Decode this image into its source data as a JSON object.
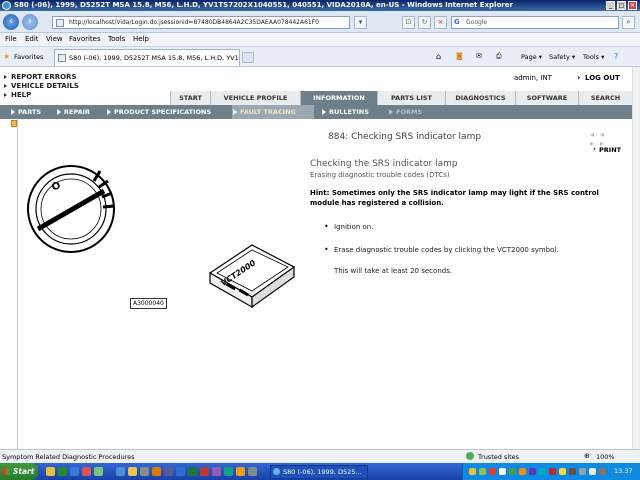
{
  "window": {
    "title": "S80 (-06), 1999, D5252T MSA 15.8, M56, L.H.D, YV1TS7202X1040551, 040551, VIDA2010A, en-US - Windows Internet Explorer"
  },
  "address_bar": {
    "url": "http://localhost/Vida/Login.do;jsessionid=87480DB4864A2C35DAEAA078442A61F0",
    "search_placeholder": "Google"
  },
  "menu": [
    "File",
    "Edit",
    "View",
    "Favorites",
    "Tools",
    "Help"
  ],
  "favorites_bar": {
    "favorites_label": "Favorites",
    "tab_title": "S80 (-06), 1999, D5252T MSA 15.8, M56, L.H.D, YV1...",
    "commands": [
      "Page ▾",
      "Safety ▾",
      "Tools ▾"
    ]
  },
  "vida": {
    "top_links": [
      "REPORT ERRORS",
      "VEHICLE DETAILS",
      "HELP"
    ],
    "user": "admin, INT",
    "logout": "LOG OUT",
    "tabs": [
      "START",
      "VEHICLE PROFILE",
      "INFORMATION",
      "PARTS LIST",
      "DIAGNOSTICS",
      "SOFTWARE",
      "SEARCH"
    ],
    "active_tab": "INFORMATION",
    "subnav": [
      "PARTS",
      "REPAIR",
      "PRODUCT SPECIFICATIONS",
      "FAULT TRACING",
      "BULLETINS",
      "FORMS"
    ],
    "active_subnav": "FAULT TRACING",
    "disabled_subnav": "FORMS",
    "document": {
      "title": "884: Checking SRS indicator lamp",
      "prev_next": "◂◂ ▸▸",
      "print": "PRINT",
      "heading": "Checking the SRS indicator lamp",
      "subheading": "Erasing diagnostic trouble codes (DTCs)",
      "hint": "Hint: Sometimes only the SRS indicator lamp may light if the SRS control module has registered a collision.",
      "steps": [
        "Ignition on.",
        "Erase diagnostic trouble codes by clicking the VCT2000 symbol."
      ],
      "note": "This will take at least 20 seconds.",
      "figure_label": "A3000040",
      "device_label": "VCT2000",
      "ignition_letter": "O"
    }
  },
  "status_bar": {
    "text": "Symptom Related Diagnostic Procedures",
    "zone": "Trusted sites",
    "zoom": "100%"
  },
  "taskbar": {
    "start": "Start",
    "active_window": "S80 (-06), 1999, D525...",
    "clock": "13.37"
  },
  "colors": {
    "nav_bar": "#6d7f8b",
    "active_subnav": "#9aa8b2",
    "titlebar": "#0a246a",
    "taskbar": "#1941a5"
  }
}
